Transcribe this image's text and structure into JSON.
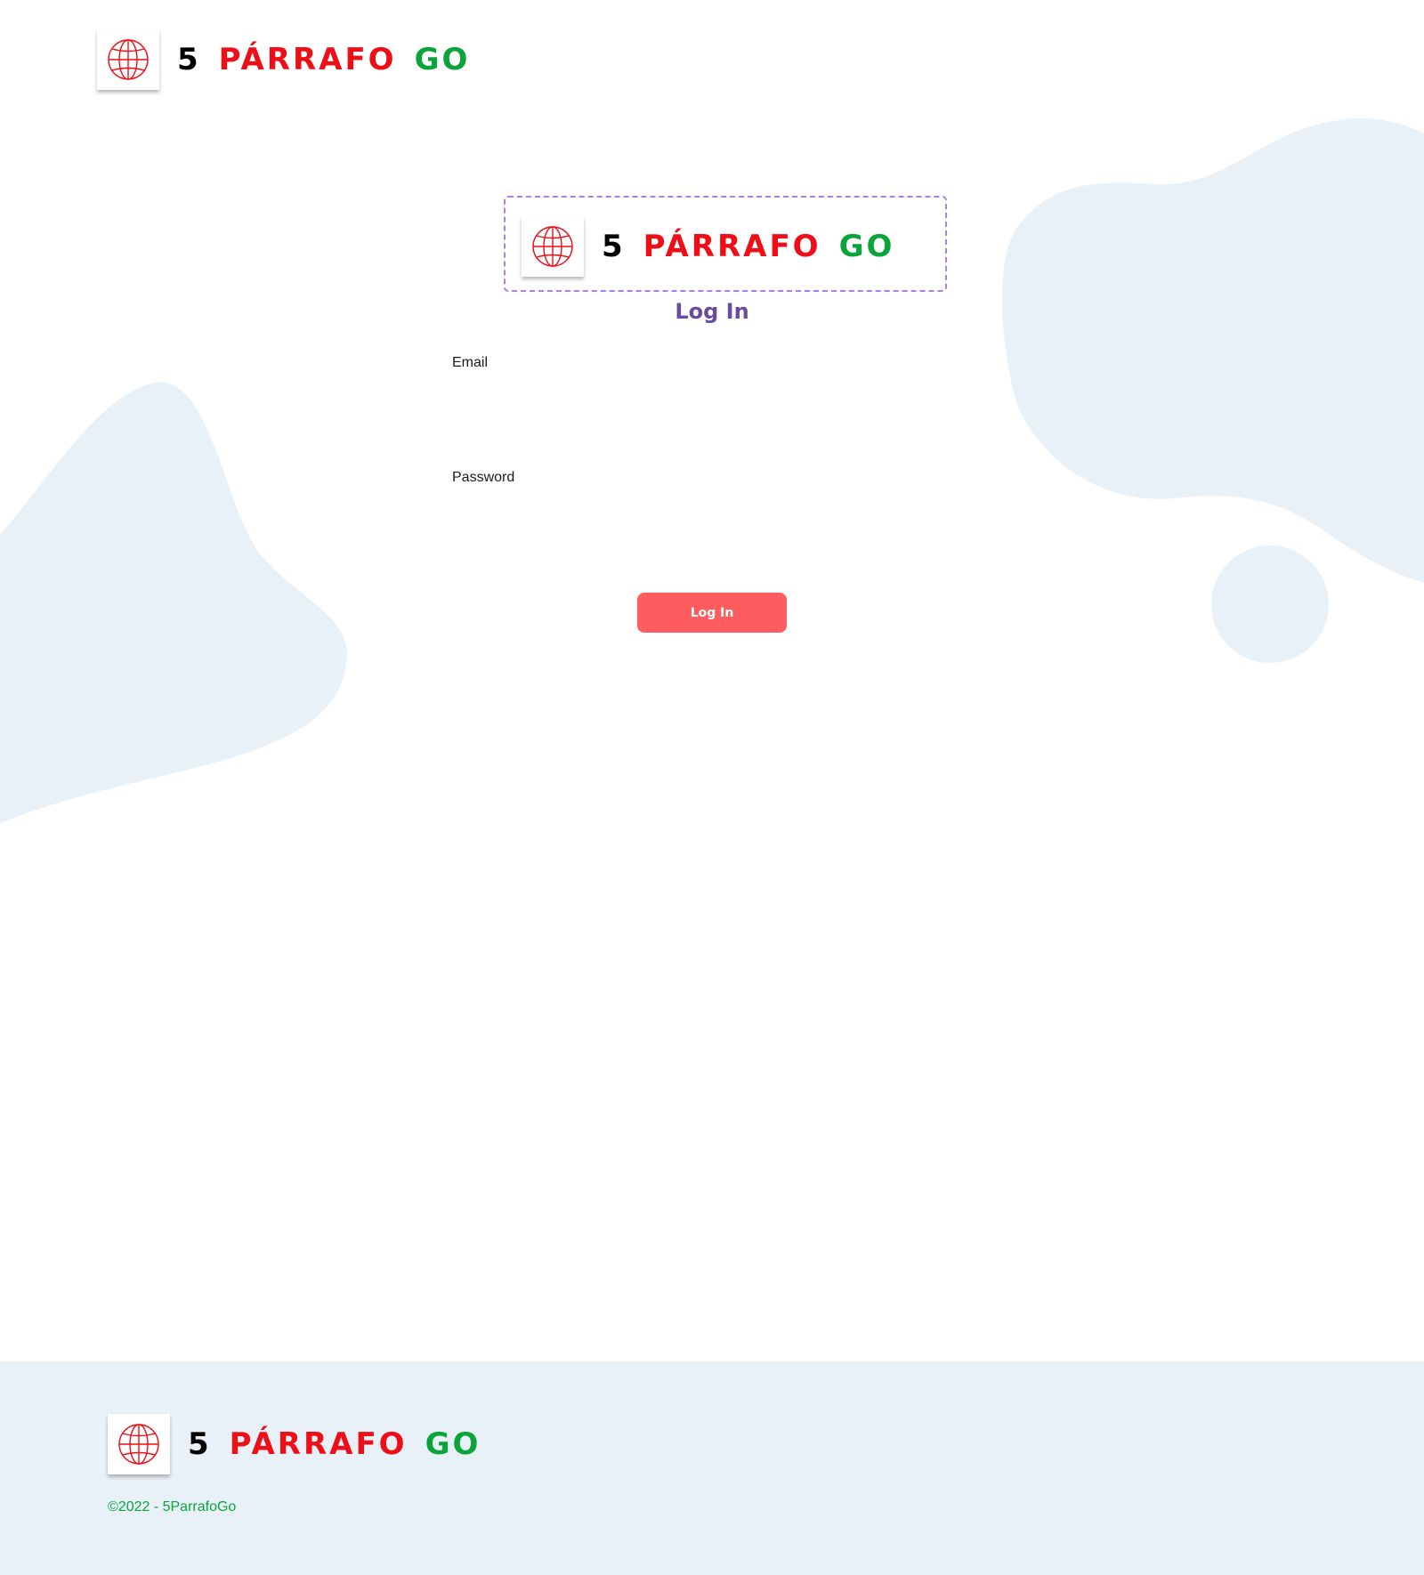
{
  "brand": {
    "word1": "5",
    "word2": "PÁRRAFO",
    "word3": "GO",
    "icon": "globe-icon"
  },
  "login": {
    "title": "Log In",
    "email_label": "Email",
    "email_value": "",
    "password_label": "Password",
    "password_value": "",
    "button_label": "Log In"
  },
  "footer": {
    "copyright": "©2022 - 5ParrafoGo"
  },
  "colors": {
    "brand_red": "#ee0e17",
    "brand_green": "#0aa43a",
    "title_purple": "#6a4a9c",
    "button_coral": "#ff5c60",
    "blob_blue": "#e8f1f8"
  }
}
